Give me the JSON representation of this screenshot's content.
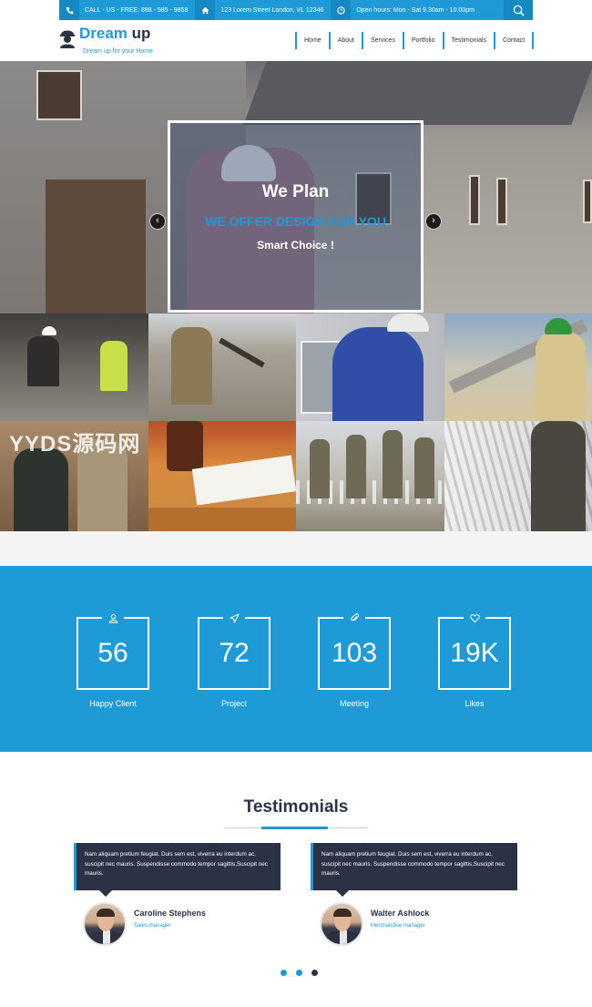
{
  "topbar": {
    "phone": "CALL - US - FREE:  888 - 585 - 9858",
    "address": "123 Lorem Street London, VL 12346",
    "hours": "Open hours: Mon - Sat 9.30am - 10.00pm"
  },
  "brand": {
    "name_first": "Dream",
    "name_second": " up",
    "tagline": "Dream up for your Home"
  },
  "nav": [
    "Home",
    "About",
    "Services",
    "Portfolio",
    "Testimonials",
    "Contact"
  ],
  "hero": {
    "title": "We Plan",
    "subtitle": "WE OFFER DESIGN FOR YOU",
    "tagline": "Smart Choice !"
  },
  "watermark": "YYDS源码网",
  "stats": [
    {
      "value": "56",
      "label": "Happy Client",
      "icon": "user-icon"
    },
    {
      "value": "72",
      "label": "Project",
      "icon": "paper-plane-icon"
    },
    {
      "value": "103",
      "label": "Meeting",
      "icon": "paperclip-icon"
    },
    {
      "value": "19K",
      "label": "Likes",
      "icon": "heart-icon"
    }
  ],
  "testimonials": {
    "title": "Testimonials",
    "items": [
      {
        "quote": "Nam aliquam pretium feugiat. Duis sem est, viverra eu interdum ac, suscipit nec mauris. Suspendisse commodo tempor sagittis,Suscipit nec mauris.",
        "name": "Caroline Stephens",
        "role": "Sales manager"
      },
      {
        "quote": "Nam aliquam pretium feugiat. Duis sem est, viverra eu interdum ac, suscipit nec mauris. Suspendisse commodo tempor sagittis,Suscipit nec mauris.",
        "name": "Walter Ashlock",
        "role": "Merchandise manager"
      }
    ]
  },
  "colors": {
    "accent": "#1e9bd7",
    "dark": "#2b3245",
    "dot_active": "#2b3245"
  }
}
